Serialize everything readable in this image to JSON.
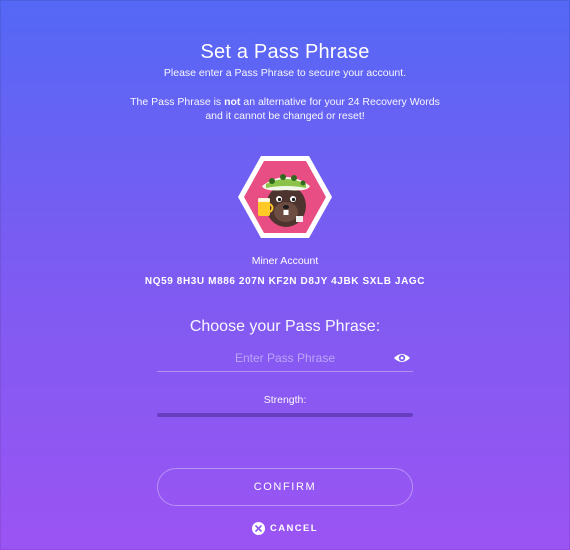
{
  "header": {
    "title": "Set a Pass Phrase",
    "subtitle": "Please enter a Pass Phrase to secure your account."
  },
  "warning": {
    "before": "The Pass Phrase is ",
    "emphasis": "not",
    "after": " an alternative for your 24 Recovery Words and it cannot be changed or reset!"
  },
  "account": {
    "label": "Miner Account",
    "address": "NQ59 8H3U M886 207N KF2N D8JY 4JBK SXLB JAGC",
    "avatar_icon": "beaver-miner-identicon"
  },
  "form": {
    "choose_label": "Choose your Pass Phrase:",
    "input_placeholder": "Enter Pass Phrase",
    "input_value": "",
    "visibility_icon": "eye-icon",
    "strength_label": "Strength:",
    "strength": 0
  },
  "actions": {
    "confirm_label": "CONFIRM",
    "cancel_label": "CANCEL",
    "cancel_icon": "close-circle-icon"
  },
  "colors": {
    "gradient_top": "#5468f5",
    "gradient_bottom": "#9b54f3",
    "avatar_hexagon": "#e84d83",
    "text": "#ffffff"
  }
}
